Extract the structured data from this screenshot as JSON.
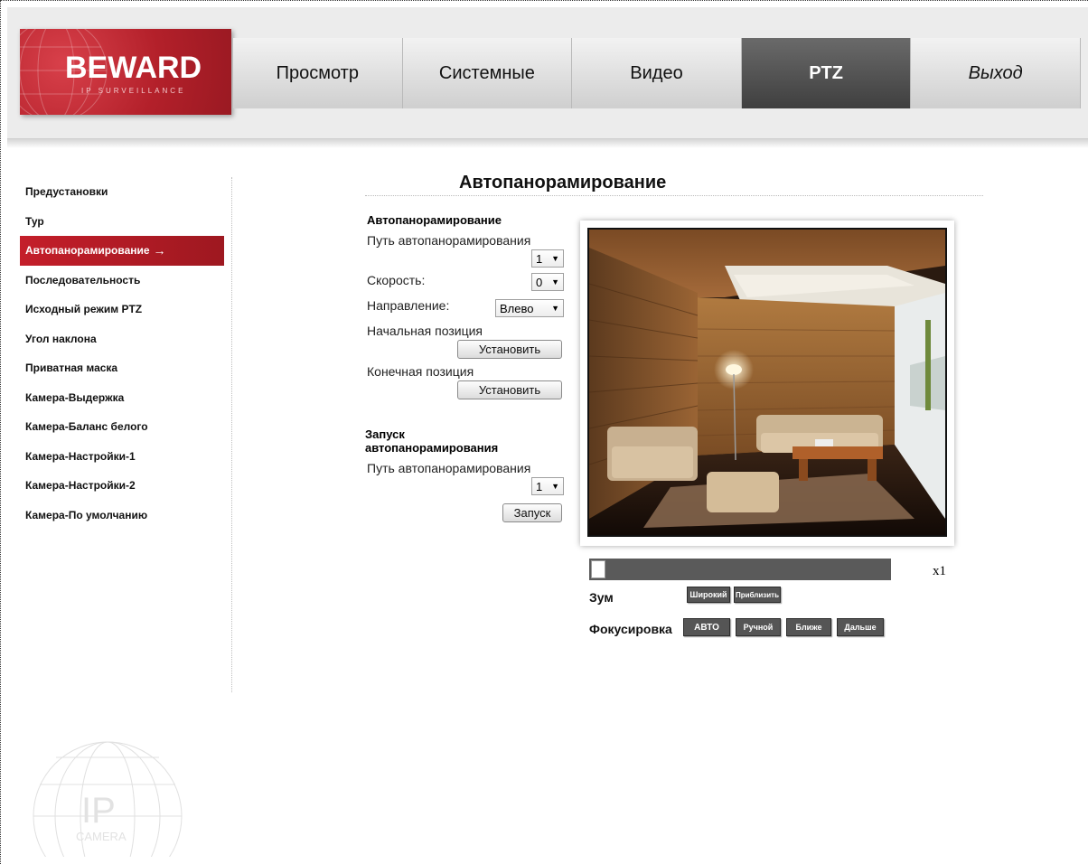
{
  "logo": {
    "name": "BEWARD",
    "tagline": "IP SURVEILLANCE"
  },
  "nav": {
    "tabs": [
      {
        "label": "Просмотр"
      },
      {
        "label": "Системные"
      },
      {
        "label": "Видео"
      },
      {
        "label": "PTZ",
        "active": true
      },
      {
        "label": "Выход"
      }
    ]
  },
  "sidebar": {
    "items": [
      {
        "label": "Предустановки"
      },
      {
        "label": "Тур"
      },
      {
        "label": "Автопанорамирование",
        "active": true,
        "arrow": "→"
      },
      {
        "label": "Последовательность"
      },
      {
        "label": "Исходный режим PTZ"
      },
      {
        "label": "Угол наклона"
      },
      {
        "label": "Приватная маска"
      },
      {
        "label": "Камера-Выдержка"
      },
      {
        "label": "Камера-Баланс белого"
      },
      {
        "label": "Камера-Настройки-1"
      },
      {
        "label": "Камера-Настройки-2"
      },
      {
        "label": "Камера-По умолчанию"
      }
    ],
    "watermark": {
      "line1": "IP",
      "line2": "CAMERA"
    }
  },
  "main": {
    "title": "Автопанорамирование",
    "settings": {
      "section_title": "Автопанорамирование",
      "path_label": "Путь автопанорамирования",
      "path_value": "1",
      "speed_label": "Скорость:",
      "speed_value": "0",
      "direction_label": "Направление:",
      "direction_value": "Влево",
      "start_label": "Начальная позиция",
      "start_button": "Установить",
      "end_label": "Конечная позиция",
      "end_button": "Установить"
    },
    "run": {
      "section_title_1": "Запуск",
      "section_title_2": "автопанорамирования",
      "path_label": "Путь автопанорамирования",
      "path_value": "1",
      "run_button": "Запуск"
    },
    "preview": {
      "zoom_level": "x1",
      "zoom_label": "Зум",
      "zoom_wide": "Широкий",
      "zoom_tele": "Приблизить",
      "focus_label": "Фокусировка",
      "focus_auto": "АВТО",
      "focus_manual": "Ручной",
      "focus_near": "Ближе",
      "focus_far": "Дальше"
    }
  },
  "colors": {
    "accent": "#b3202a",
    "active_tab": "#4a4a4a",
    "control_button": "#555555"
  }
}
